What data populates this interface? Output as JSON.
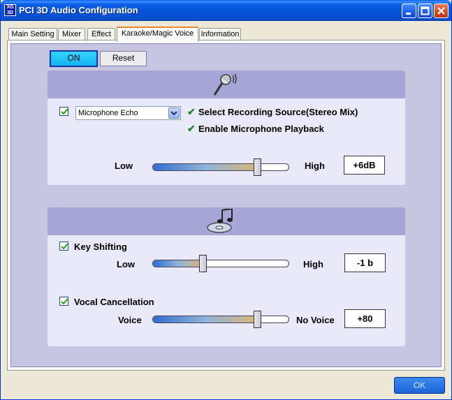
{
  "window": {
    "title": "PCI 3D Audio Configuration",
    "app_icon_text": "XG 3D"
  },
  "tabs": [
    {
      "label": "Main Setting",
      "active": false
    },
    {
      "label": "Mixer",
      "active": false
    },
    {
      "label": "Effect",
      "active": false
    },
    {
      "label": "Karaoke/Magic Voice",
      "active": true
    },
    {
      "label": "Information",
      "active": false
    }
  ],
  "controls": {
    "on_label": "ON",
    "reset_label": "Reset"
  },
  "microphone": {
    "icon": "microphone-icon",
    "enabled": true,
    "effect_select": "Microphone Echo",
    "option_recording_source": "Select Recording Source(Stereo Mix)",
    "option_playback": "Enable Microphone Playback",
    "slider_low": "Low",
    "slider_high": "High",
    "slider_level": 0.77,
    "value": "+6dB"
  },
  "music": {
    "icon": "music-cd-icon",
    "key_shifting": {
      "checked": true,
      "label": "Key Shifting",
      "low": "Low",
      "high": "High",
      "level": 0.37,
      "value": "-1 b"
    },
    "vocal_cancellation": {
      "checked": true,
      "label": "Vocal Cancellation",
      "low": "Voice",
      "high": "No Voice",
      "level": 0.77,
      "value": "+80"
    }
  },
  "ok_label": "OK",
  "colors": {
    "titlebar": "#0a5fe6",
    "panel": "#c6c6e3",
    "section_head": "#a6a7d7",
    "on_button": "#22c4f8"
  }
}
